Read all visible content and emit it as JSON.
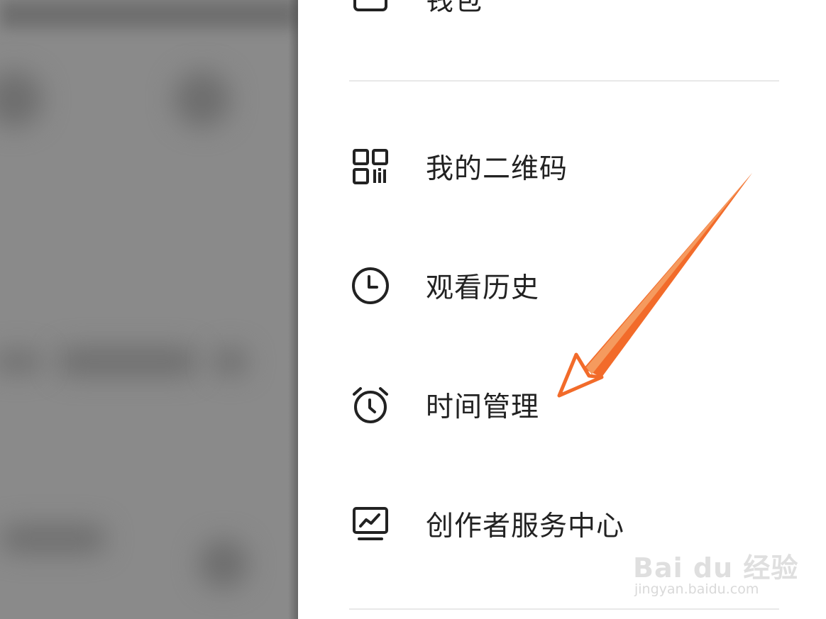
{
  "drawer": {
    "items": [
      {
        "label": "钱包",
        "icon": "wallet-icon"
      },
      {
        "label": "我的二维码",
        "icon": "qr-code-icon"
      },
      {
        "label": "观看历史",
        "icon": "clock-icon"
      },
      {
        "label": "时间管理",
        "icon": "alarm-clock-icon"
      },
      {
        "label": "创作者服务中心",
        "icon": "creator-chart-icon"
      }
    ]
  },
  "annotation": {
    "arrow_color": "#f26b2a"
  },
  "watermark": {
    "brand": "Bai du 经验",
    "url": "jingyan.baidu.com"
  },
  "colors": {
    "text": "#222222",
    "divider": "#e8e8e8",
    "backdrop": "#8a8a8a"
  }
}
